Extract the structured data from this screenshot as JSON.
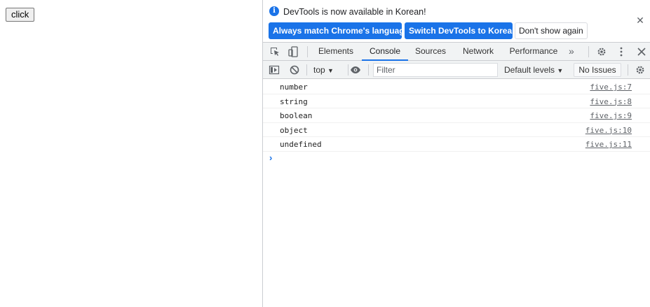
{
  "page": {
    "button_label": "click"
  },
  "infobar": {
    "icon": "info-icon",
    "message": "DevTools is now available in Korean!",
    "buttons": {
      "match_language": "Always match Chrome's language",
      "switch_korean": "Switch DevTools to Korean",
      "dont_show": "Don't show again"
    },
    "close_icon": "close-icon"
  },
  "tabbar": {
    "tabs": [
      "Elements",
      "Console",
      "Sources",
      "Network",
      "Performance"
    ],
    "active_tab": "Console",
    "more_icon": "»"
  },
  "console_toolbar": {
    "context": "top",
    "filter_placeholder": "Filter",
    "levels": "Default levels",
    "issues": "No Issues"
  },
  "messages": [
    {
      "text": "number",
      "source": "five.js:7"
    },
    {
      "text": "string",
      "source": "five.js:8"
    },
    {
      "text": "boolean",
      "source": "five.js:9"
    },
    {
      "text": "object",
      "source": "five.js:10"
    },
    {
      "text": "undefined",
      "source": "five.js:11"
    }
  ],
  "colors": {
    "accent": "#1a73e8",
    "toolbar_bg": "#f1f3f4",
    "border": "#cbcdd1"
  }
}
